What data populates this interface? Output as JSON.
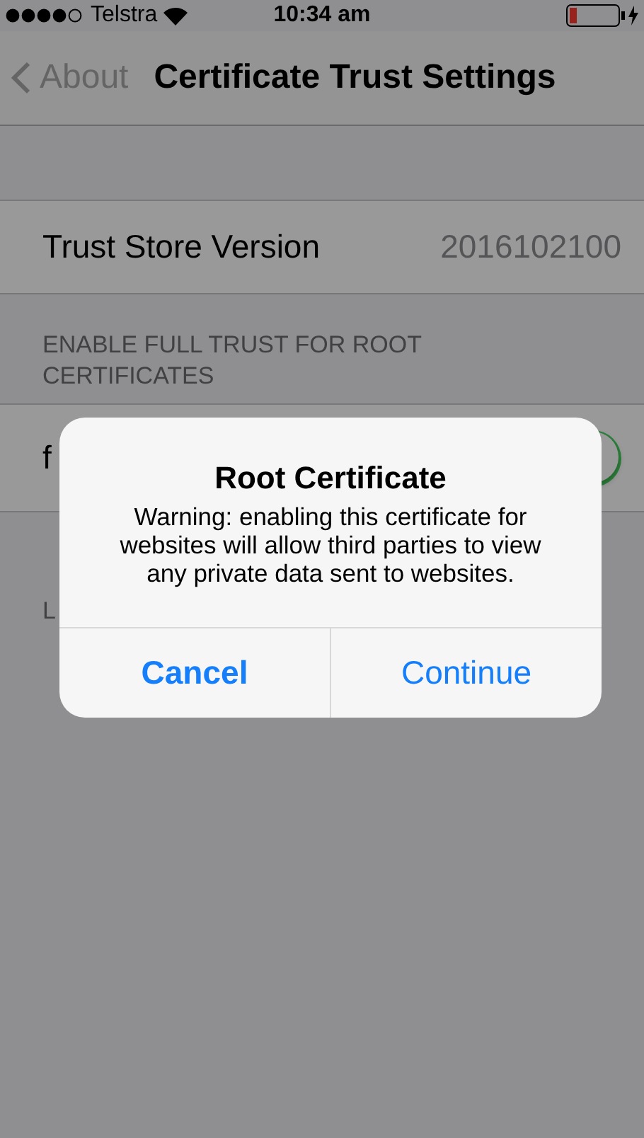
{
  "status_bar": {
    "carrier": "Telstra",
    "time": "10:34 am"
  },
  "nav_bar": {
    "back_label": "About",
    "title": "Certificate Trust Settings"
  },
  "trust_store": {
    "label": "Trust Store Version",
    "value": "2016102100"
  },
  "section_header": "ENABLE FULL TRUST FOR ROOT CERTIFICATES",
  "certificate_row": {
    "label": "f",
    "on": true
  },
  "footer": "L",
  "alert": {
    "title": "Root Certificate",
    "message": "Warning: enabling this certificate for websites will allow third parties to view any private data sent to websites.",
    "buttons": [
      {
        "label": "Cancel",
        "kind": "cancel"
      },
      {
        "label": "Continue",
        "kind": "default"
      }
    ]
  }
}
